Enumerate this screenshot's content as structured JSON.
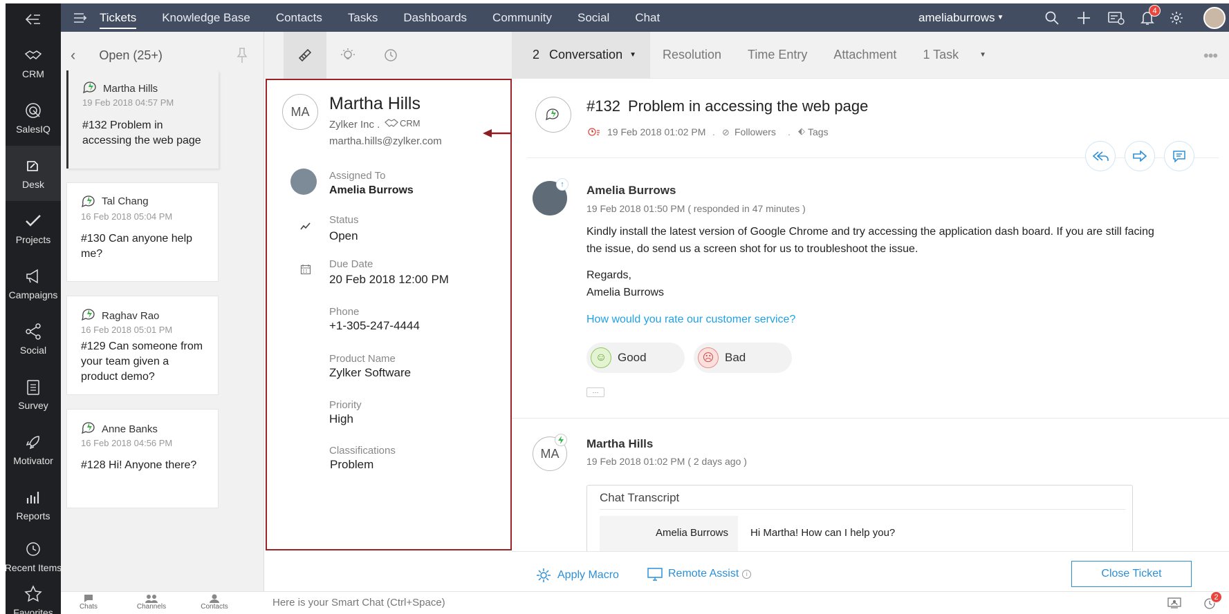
{
  "rail": {
    "items": [
      {
        "label": "CRM",
        "icon": "handshake-icon"
      },
      {
        "label": "SalesIQ",
        "icon": "target-icon"
      },
      {
        "label": "Desk",
        "icon": "desk-icon"
      },
      {
        "label": "Projects",
        "icon": "checkmark-icon"
      },
      {
        "label": "Campaigns",
        "icon": "megaphone-icon"
      },
      {
        "label": "Social",
        "icon": "share-icon"
      },
      {
        "label": "Survey",
        "icon": "clipboard-icon"
      },
      {
        "label": "Motivator",
        "icon": "rocket-icon"
      },
      {
        "label": "Reports",
        "icon": "bar-chart-icon"
      },
      {
        "label": "Recent Items",
        "icon": "history-icon"
      },
      {
        "label": "Favorites",
        "icon": "star-icon"
      }
    ]
  },
  "topnav": {
    "tabs": [
      "Tickets",
      "Knowledge Base",
      "Contacts",
      "Tasks",
      "Dashboards",
      "Community",
      "Social",
      "Chat"
    ],
    "user": "ameliaburrows",
    "notification_count": "4"
  },
  "list": {
    "title": "Open (25+)",
    "tickets": [
      {
        "name": "Martha Hills",
        "date": "19 Feb 2018 04:57 PM",
        "subject": "#132  Problem in accessing the web page"
      },
      {
        "name": "Tal Chang",
        "date": "16 Feb 2018 05:04 PM",
        "subject": "#130 Can anyone help me?"
      },
      {
        "name": "Raghav Rao",
        "date": "16 Feb 2018 05:01 PM",
        "subject": "#129  Can someone from your team given a product demo?"
      },
      {
        "name": "Anne Banks",
        "date": "16 Feb 2018 04:56 PM",
        "subject": "#128  Hi! Anyone there?"
      }
    ]
  },
  "contact": {
    "initials": "MA",
    "name": "Martha Hills",
    "company": "Zylker Inc .",
    "crm": "CRM",
    "email": "martha.hills@zylker.com"
  },
  "props": {
    "assigned_label": "Assigned To",
    "assigned_value": "Amelia Burrows",
    "status_label": "Status",
    "status_value": "Open",
    "due_label": "Due Date",
    "due_value": "20 Feb 2018 12:00 PM",
    "phone_label": "Phone",
    "phone_value": "+1-305-247-4444",
    "product_label": "Product Name",
    "product_value": "Zylker Software",
    "priority_label": "Priority",
    "priority_value": "High",
    "class_label": "Classifications",
    "class_value": "Problem"
  },
  "conv_tabs": {
    "conversation_count": "2",
    "conversation": "Conversation",
    "resolution": "Resolution",
    "time_entry": "Time Entry",
    "attachment": "Attachment",
    "task": "1 Task"
  },
  "ticket": {
    "number": "#132",
    "subject": "Problem in accessing the web page",
    "date": "19 Feb 2018 01:02 PM",
    "followers": "Followers",
    "tags": "Tags"
  },
  "thread1": {
    "author": "Amelia Burrows",
    "meta": "19 Feb 2018 01:50 PM ( responded in 47 minutes )",
    "body1": "Kindly install the latest version of Google Chrome and try accessing the application dash board.  If you are still facing",
    "body2": "the issue, do send us a screen shot for us to troubleshoot the issue.",
    "regards": "Regards,",
    "signature": "Amelia Burrows",
    "rating_prompt": "How would you rate our customer service?",
    "good": "Good",
    "bad": "Bad",
    "more": "···"
  },
  "thread2": {
    "initials": "MA",
    "author": "Martha Hills",
    "meta": "19 Feb 2018 01:02 PM ( 2 days ago )",
    "transcript_title": "Chat Transcript",
    "chat_name": "Amelia Burrows",
    "chat_message": "Hi Martha! How can I help you?"
  },
  "footer": {
    "apply_macro": "Apply Macro",
    "remote_assist": "Remote Assist",
    "close_ticket": "Close Ticket"
  },
  "bottombar": {
    "chats": "Chats",
    "channels": "Channels",
    "contacts": "Contacts",
    "smart_chat": "Here is your Smart Chat (Ctrl+Space)",
    "alarm_count": "2"
  },
  "colors": {
    "topbar": "#434d62",
    "rail": "#1f2023",
    "accent_blue": "#2b8fd8",
    "highlight_frame": "#9b2328",
    "ticket_icon_green": "#3cb34a"
  }
}
